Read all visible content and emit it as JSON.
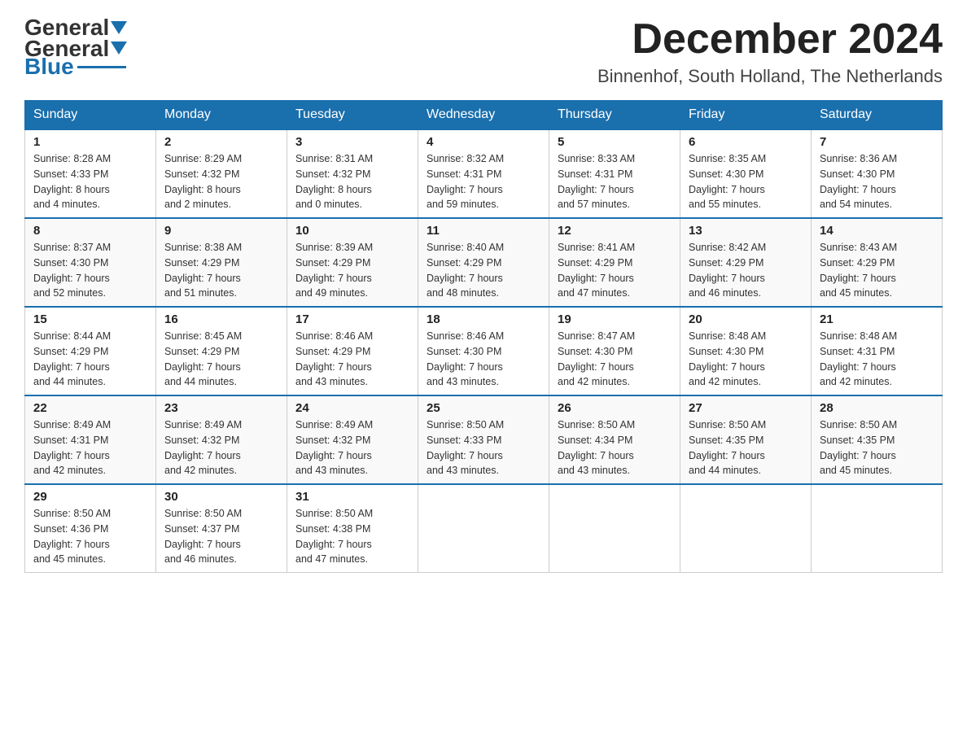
{
  "logo": {
    "general": "General",
    "blue": "Blue"
  },
  "title": {
    "month": "December 2024",
    "location": "Binnenhof, South Holland, The Netherlands"
  },
  "weekdays": [
    "Sunday",
    "Monday",
    "Tuesday",
    "Wednesday",
    "Thursday",
    "Friday",
    "Saturday"
  ],
  "weeks": [
    [
      {
        "day": "1",
        "sunrise": "8:28 AM",
        "sunset": "4:33 PM",
        "daylight": "8 hours and 4 minutes."
      },
      {
        "day": "2",
        "sunrise": "8:29 AM",
        "sunset": "4:32 PM",
        "daylight": "8 hours and 2 minutes."
      },
      {
        "day": "3",
        "sunrise": "8:31 AM",
        "sunset": "4:32 PM",
        "daylight": "8 hours and 0 minutes."
      },
      {
        "day": "4",
        "sunrise": "8:32 AM",
        "sunset": "4:31 PM",
        "daylight": "7 hours and 59 minutes."
      },
      {
        "day": "5",
        "sunrise": "8:33 AM",
        "sunset": "4:31 PM",
        "daylight": "7 hours and 57 minutes."
      },
      {
        "day": "6",
        "sunrise": "8:35 AM",
        "sunset": "4:30 PM",
        "daylight": "7 hours and 55 minutes."
      },
      {
        "day": "7",
        "sunrise": "8:36 AM",
        "sunset": "4:30 PM",
        "daylight": "7 hours and 54 minutes."
      }
    ],
    [
      {
        "day": "8",
        "sunrise": "8:37 AM",
        "sunset": "4:30 PM",
        "daylight": "7 hours and 52 minutes."
      },
      {
        "day": "9",
        "sunrise": "8:38 AM",
        "sunset": "4:29 PM",
        "daylight": "7 hours and 51 minutes."
      },
      {
        "day": "10",
        "sunrise": "8:39 AM",
        "sunset": "4:29 PM",
        "daylight": "7 hours and 49 minutes."
      },
      {
        "day": "11",
        "sunrise": "8:40 AM",
        "sunset": "4:29 PM",
        "daylight": "7 hours and 48 minutes."
      },
      {
        "day": "12",
        "sunrise": "8:41 AM",
        "sunset": "4:29 PM",
        "daylight": "7 hours and 47 minutes."
      },
      {
        "day": "13",
        "sunrise": "8:42 AM",
        "sunset": "4:29 PM",
        "daylight": "7 hours and 46 minutes."
      },
      {
        "day": "14",
        "sunrise": "8:43 AM",
        "sunset": "4:29 PM",
        "daylight": "7 hours and 45 minutes."
      }
    ],
    [
      {
        "day": "15",
        "sunrise": "8:44 AM",
        "sunset": "4:29 PM",
        "daylight": "7 hours and 44 minutes."
      },
      {
        "day": "16",
        "sunrise": "8:45 AM",
        "sunset": "4:29 PM",
        "daylight": "7 hours and 44 minutes."
      },
      {
        "day": "17",
        "sunrise": "8:46 AM",
        "sunset": "4:29 PM",
        "daylight": "7 hours and 43 minutes."
      },
      {
        "day": "18",
        "sunrise": "8:46 AM",
        "sunset": "4:30 PM",
        "daylight": "7 hours and 43 minutes."
      },
      {
        "day": "19",
        "sunrise": "8:47 AM",
        "sunset": "4:30 PM",
        "daylight": "7 hours and 42 minutes."
      },
      {
        "day": "20",
        "sunrise": "8:48 AM",
        "sunset": "4:30 PM",
        "daylight": "7 hours and 42 minutes."
      },
      {
        "day": "21",
        "sunrise": "8:48 AM",
        "sunset": "4:31 PM",
        "daylight": "7 hours and 42 minutes."
      }
    ],
    [
      {
        "day": "22",
        "sunrise": "8:49 AM",
        "sunset": "4:31 PM",
        "daylight": "7 hours and 42 minutes."
      },
      {
        "day": "23",
        "sunrise": "8:49 AM",
        "sunset": "4:32 PM",
        "daylight": "7 hours and 42 minutes."
      },
      {
        "day": "24",
        "sunrise": "8:49 AM",
        "sunset": "4:32 PM",
        "daylight": "7 hours and 43 minutes."
      },
      {
        "day": "25",
        "sunrise": "8:50 AM",
        "sunset": "4:33 PM",
        "daylight": "7 hours and 43 minutes."
      },
      {
        "day": "26",
        "sunrise": "8:50 AM",
        "sunset": "4:34 PM",
        "daylight": "7 hours and 43 minutes."
      },
      {
        "day": "27",
        "sunrise": "8:50 AM",
        "sunset": "4:35 PM",
        "daylight": "7 hours and 44 minutes."
      },
      {
        "day": "28",
        "sunrise": "8:50 AM",
        "sunset": "4:35 PM",
        "daylight": "7 hours and 45 minutes."
      }
    ],
    [
      {
        "day": "29",
        "sunrise": "8:50 AM",
        "sunset": "4:36 PM",
        "daylight": "7 hours and 45 minutes."
      },
      {
        "day": "30",
        "sunrise": "8:50 AM",
        "sunset": "4:37 PM",
        "daylight": "7 hours and 46 minutes."
      },
      {
        "day": "31",
        "sunrise": "8:50 AM",
        "sunset": "4:38 PM",
        "daylight": "7 hours and 47 minutes."
      },
      null,
      null,
      null,
      null
    ]
  ]
}
